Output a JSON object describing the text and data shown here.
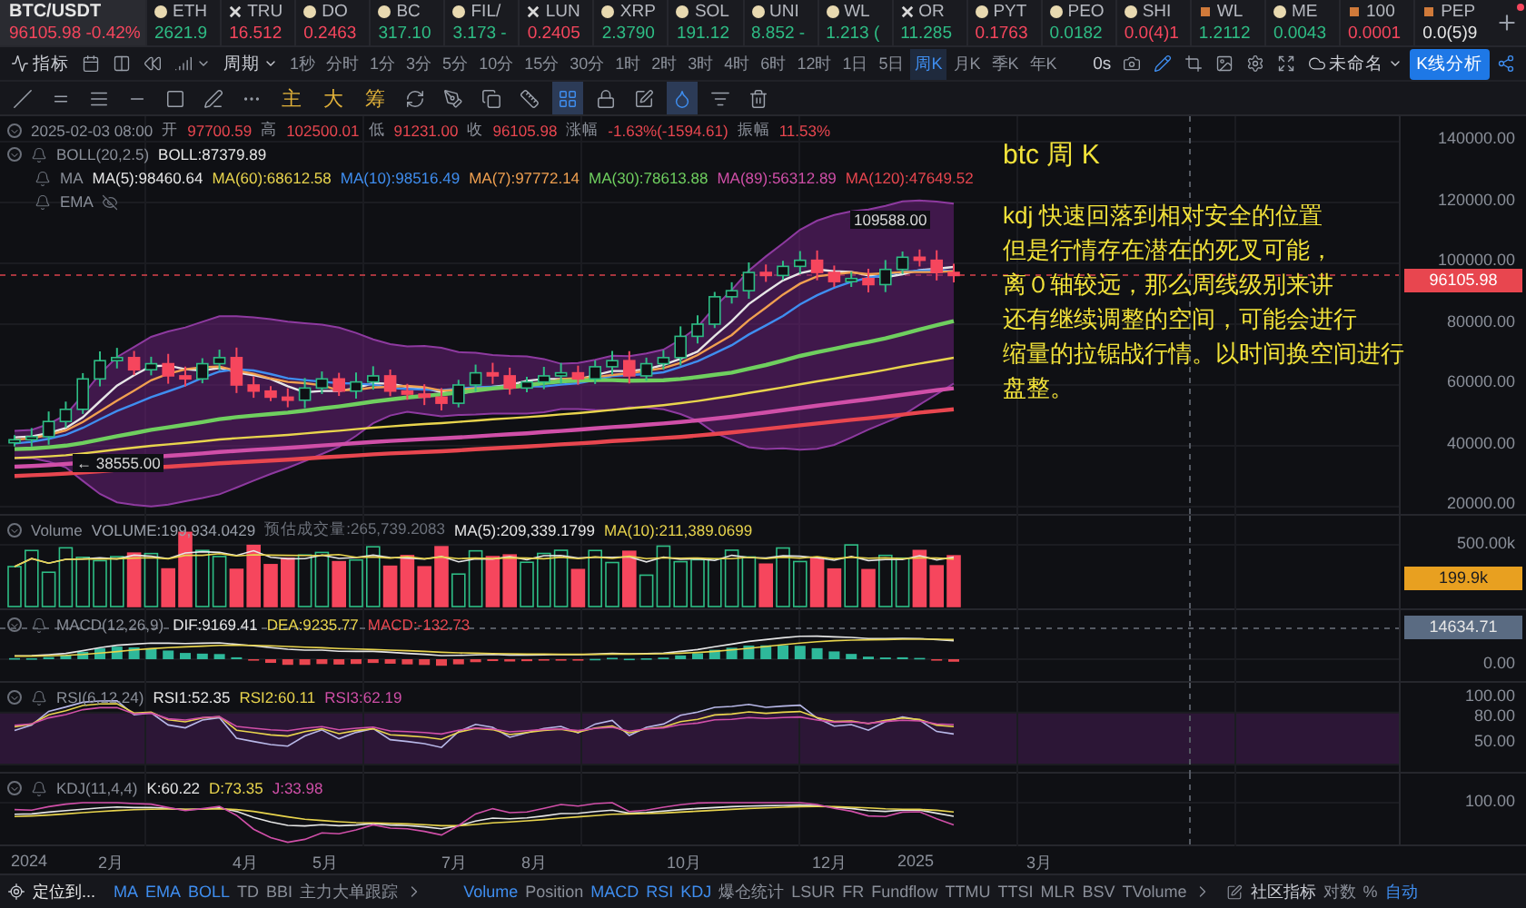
{
  "ticker_bar": {
    "pair": "BTC/USDT",
    "price": "96105.98",
    "change": "-0.42%",
    "color": "#f6465d",
    "tickers": [
      {
        "kind": "coin",
        "name": "ETH",
        "price": "2621.9",
        "color": "#2ebd85"
      },
      {
        "kind": "cross",
        "name": "TRU",
        "price": "16.512",
        "color": "#f6465d"
      },
      {
        "kind": "coin",
        "name": "DO",
        "price": "0.2463",
        "color": "#f6465d"
      },
      {
        "kind": "coin",
        "name": "BC",
        "price": "317.10",
        "color": "#2ebd85"
      },
      {
        "kind": "coin",
        "name": "FIL/",
        "price": "3.173 -",
        "color": "#2ebd85"
      },
      {
        "kind": "cross",
        "name": "LUN",
        "price": "0.2405",
        "color": "#f6465d"
      },
      {
        "kind": "coin",
        "name": "XRP",
        "price": "2.3790",
        "color": "#2ebd85"
      },
      {
        "kind": "coin",
        "name": "SOL",
        "price": "191.12",
        "color": "#2ebd85"
      },
      {
        "kind": "coin",
        "name": "UNI",
        "price": "8.852 -",
        "color": "#2ebd85"
      },
      {
        "kind": "coin",
        "name": "WL",
        "price": "1.213 (",
        "color": "#2ebd85"
      },
      {
        "kind": "cross",
        "name": "OR",
        "price": "11.285",
        "color": "#2ebd85"
      },
      {
        "kind": "coin",
        "name": "PYT",
        "price": "0.1763",
        "color": "#f6465d"
      },
      {
        "kind": "coin",
        "name": "PEO",
        "price": "0.0182",
        "color": "#2ebd85"
      },
      {
        "kind": "coin",
        "name": "SHI",
        "price": "0.0(4)1",
        "color": "#f6465d"
      },
      {
        "kind": "square",
        "name": "WL",
        "price": "1.2112",
        "color": "#2ebd85"
      },
      {
        "kind": "coin",
        "name": "ME",
        "price": "0.0043",
        "color": "#2ebd85"
      },
      {
        "kind": "square",
        "name": "100",
        "price": "0.0001",
        "color": "#f6465d"
      },
      {
        "kind": "square",
        "name": "PEP",
        "price": "0.0(5)9",
        "color": "#e6e6e6"
      }
    ]
  },
  "toolbar": {
    "indicators_label": "指标",
    "period_label": "周期",
    "periods": [
      {
        "label": "1秒",
        "selected": false
      },
      {
        "label": "分时",
        "selected": false
      },
      {
        "label": "1分",
        "selected": false
      },
      {
        "label": "3分",
        "selected": false
      },
      {
        "label": "5分",
        "selected": false
      },
      {
        "label": "10分",
        "selected": false
      },
      {
        "label": "15分",
        "selected": false
      },
      {
        "label": "30分",
        "selected": false
      },
      {
        "label": "1时",
        "selected": false
      },
      {
        "label": "2时",
        "selected": false
      },
      {
        "label": "3时",
        "selected": false
      },
      {
        "label": "4时",
        "selected": false
      },
      {
        "label": "6时",
        "selected": false
      },
      {
        "label": "12时",
        "selected": false
      },
      {
        "label": "1日",
        "selected": false
      },
      {
        "label": "5日",
        "selected": false
      },
      {
        "label": "周K",
        "selected": true
      },
      {
        "label": "月K",
        "selected": false
      },
      {
        "label": "季K",
        "selected": false
      },
      {
        "label": "年K",
        "selected": false
      }
    ],
    "timer": "0s",
    "layout_name": "未命名",
    "analysis_button": "K线分析"
  },
  "drawing_toolbar": {
    "quick_indicators": [
      "主",
      "大",
      "筹"
    ],
    "tools": [
      {
        "selected": false
      },
      {
        "selected": false
      },
      {
        "selected": false
      },
      {
        "selected": false
      },
      {
        "selected": true
      },
      {
        "selected": false
      },
      {
        "selected": false
      },
      {
        "selected": true
      },
      {
        "selected": false
      },
      {
        "selected": false
      }
    ]
  },
  "main_chart": {
    "datetime": "2025-02-03 08:00",
    "ohlc": [
      {
        "label": "开",
        "value": "97700.59"
      },
      {
        "label": "高",
        "value": "102500.01"
      },
      {
        "label": "低",
        "value": "91231.00"
      },
      {
        "label": "收",
        "value": "96105.98"
      },
      {
        "label": "涨幅",
        "value": "-1.63%(-1594.61)"
      },
      {
        "label": "振幅",
        "value": "11.53%"
      }
    ],
    "legends": [
      {
        "name": "BOLL(20,2.5)",
        "hidden": false,
        "values": [
          {
            "text": "BOLL:87379.89",
            "color": "#e6e6e6"
          }
        ]
      },
      {
        "name": "MA",
        "hidden": false,
        "values": [
          {
            "text": "MA(5):98460.64",
            "color": "#e6e6e6"
          },
          {
            "text": "MA(60):68612.58",
            "color": "#e8d44d"
          },
          {
            "text": "MA(10):98516.49",
            "color": "#3f8ef0"
          },
          {
            "text": "MA(7):97772.14",
            "color": "#f0a050"
          },
          {
            "text": "MA(30):78613.88",
            "color": "#6fcf5f"
          },
          {
            "text": "MA(89):56312.89",
            "color": "#d04fa8"
          },
          {
            "text": "MA(120):47649.52",
            "color": "#e8464f"
          }
        ]
      },
      {
        "name": "EMA",
        "hidden": true
      }
    ],
    "high_label": "109588.00",
    "low_label": "← 38555.00",
    "axis_labels": [
      "140000.00",
      "120000.00",
      "100000.00",
      "80000.00",
      "60000.00",
      "40000.00",
      "20000.00"
    ],
    "price_tag": "96105.98",
    "annotation": {
      "title": "btc 周 K",
      "lines": [
        "kdj 快速回落到相对安全的位置",
        "但是行情存在潜在的死叉可能，",
        "离０轴较远，那么周线级别来讲",
        "还有继续调整的空间，可能会进行",
        "缩量的拉锯战行情。以时间换空间进行",
        "盘整。"
      ]
    }
  },
  "volume_panel": {
    "name": "Volume",
    "values": [
      {
        "text": "VOLUME:199,934.0429",
        "color": "#9aa0aa"
      },
      {
        "text": "预估成交量:265,739.2083",
        "color": "#6b707a"
      },
      {
        "text": "MA(5):209,339.1799",
        "color": "#e6e6e6"
      },
      {
        "text": "MA(10):211,389.0699",
        "color": "#e8d44d"
      }
    ],
    "axis_labels": [
      "500.00k"
    ],
    "tag": "199.9k"
  },
  "macd_panel": {
    "name": "MACD(12,26,9)",
    "values": [
      {
        "text": "DIF:9169.41",
        "color": "#e6e6e6"
      },
      {
        "text": "DEA:9235.77",
        "color": "#e8d44d"
      },
      {
        "text": "MACD:-132.73",
        "color": "#e8464f"
      }
    ],
    "axis_labels": [
      "0.00"
    ],
    "tag": "14634.71"
  },
  "rsi_panel": {
    "name": "RSI(6,12,24)",
    "values": [
      {
        "text": "RSI1:52.35",
        "color": "#e6e6e6"
      },
      {
        "text": "RSI2:60.11",
        "color": "#e8d44d"
      },
      {
        "text": "RSI3:62.19",
        "color": "#d04fa8"
      }
    ],
    "axis_labels": [
      "100.00",
      "80.00",
      "50.00"
    ]
  },
  "kdj_panel": {
    "name": "KDJ(11,4,4)",
    "values": [
      {
        "text": "K:60.22",
        "color": "#e6e6e6"
      },
      {
        "text": "D:73.35",
        "color": "#e8d44d"
      },
      {
        "text": "J:33.98",
        "color": "#d04fa8"
      }
    ],
    "axis_labels": [
      "100.00"
    ]
  },
  "time_axis": [
    "2024",
    "2月",
    "4月",
    "5月",
    "7月",
    "8月",
    "10月",
    "12月",
    "2025",
    "3月"
  ],
  "bottom_bar": {
    "locate": "定位到...",
    "main_indicators": [
      {
        "label": "MA",
        "selected": true
      },
      {
        "label": "EMA",
        "selected": true
      },
      {
        "label": "BOLL",
        "selected": true
      },
      {
        "label": "TD",
        "selected": false
      },
      {
        "label": "BBI",
        "selected": false
      },
      {
        "label": "主力大单跟踪",
        "selected": false
      }
    ],
    "sub_indicators": [
      {
        "label": "Volume",
        "selected": true
      },
      {
        "label": "Position",
        "selected": false
      },
      {
        "label": "MACD",
        "selected": true
      },
      {
        "label": "RSI",
        "selected": true
      },
      {
        "label": "KDJ",
        "selected": true
      },
      {
        "label": "爆仓统计",
        "selected": false
      },
      {
        "label": "LSUR",
        "selected": false
      },
      {
        "label": "FR",
        "selected": false
      },
      {
        "label": "Fundflow",
        "selected": false
      },
      {
        "label": "TTMU",
        "selected": false
      },
      {
        "label": "TTSI",
        "selected": false
      },
      {
        "label": "MLR",
        "selected": false
      },
      {
        "label": "BSV",
        "selected": false
      },
      {
        "label": "TVolume",
        "selected": false
      }
    ],
    "community": "社区指标",
    "scale_options": [
      {
        "label": "对数",
        "selected": false
      },
      {
        "label": "%",
        "selected": false
      },
      {
        "label": "自动",
        "selected": true
      }
    ]
  }
}
